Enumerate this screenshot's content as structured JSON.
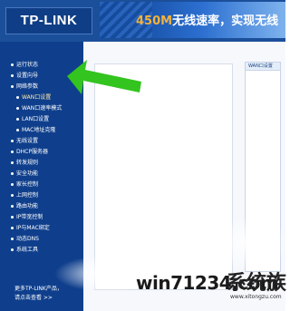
{
  "header": {
    "logo": "TP-LINK",
    "banner_accent": "450M",
    "banner_text": "无线速率，实现无线"
  },
  "sidebar": {
    "items": [
      {
        "label": "运行状态",
        "sub": false
      },
      {
        "label": "设置向导",
        "sub": false
      },
      {
        "label": "网络参数",
        "sub": false
      },
      {
        "label": "WAN口设置",
        "sub": true,
        "active": true
      },
      {
        "label": "WAN口速率模式",
        "sub": true
      },
      {
        "label": "LAN口设置",
        "sub": true
      },
      {
        "label": "MAC地址克隆",
        "sub": true
      },
      {
        "label": "无线设置",
        "sub": false
      },
      {
        "label": "DHCP服务器",
        "sub": false
      },
      {
        "label": "转发规则",
        "sub": false
      },
      {
        "label": "安全功能",
        "sub": false
      },
      {
        "label": "家长控制",
        "sub": false
      },
      {
        "label": "上网控制",
        "sub": false
      },
      {
        "label": "路由功能",
        "sub": false
      },
      {
        "label": "IP带宽控制",
        "sub": false
      },
      {
        "label": "IP与MAC绑定",
        "sub": false
      },
      {
        "label": "动态DNS",
        "sub": false
      },
      {
        "label": "系统工具",
        "sub": false
      }
    ],
    "more_line1": "更多TP-LINK产品，",
    "more_line2": "请点击查看 >>"
  },
  "content": {
    "right_panel_header": "WAN口设置"
  },
  "watermark": {
    "text": "win71234.com",
    "cn": "系统族",
    "sub": "www.xitongzu.com"
  },
  "colors": {
    "sidebar_bg": "#0f3f8c",
    "header_bg": "#1b4f9a",
    "banner_accent": "#f3b23c",
    "arrow": "#33c41f"
  }
}
